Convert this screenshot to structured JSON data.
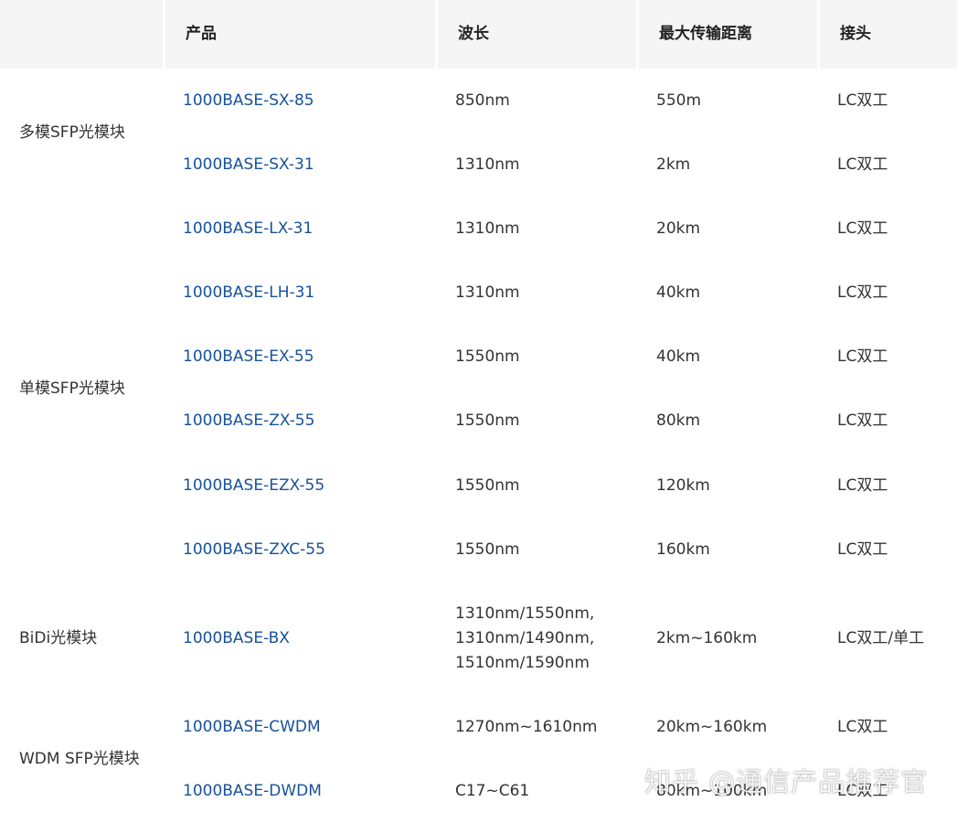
{
  "header": {
    "category": "",
    "product": "产品",
    "wavelength": "波长",
    "distance": "最大传输距离",
    "connector": "接头"
  },
  "categories": {
    "multimode": "多模SFP光模块",
    "singlemode": "单模SFP光模块",
    "bidi": "BiDi光模块",
    "wdm": "WDM SFP光模块"
  },
  "rows": [
    {
      "product": "1000BASE-SX-85",
      "wavelength": "850nm",
      "distance": "550m",
      "connector": "LC双工"
    },
    {
      "product": "1000BASE-SX-31",
      "wavelength": "1310nm",
      "distance": "2km",
      "connector": "LC双工"
    },
    {
      "product": "1000BASE-LX-31",
      "wavelength": "1310nm",
      "distance": "20km",
      "connector": "LC双工"
    },
    {
      "product": "1000BASE-LH-31",
      "wavelength": "1310nm",
      "distance": "40km",
      "connector": "LC双工"
    },
    {
      "product": "1000BASE-EX-55",
      "wavelength": "1550nm",
      "distance": "40km",
      "connector": "LC双工"
    },
    {
      "product": "1000BASE-ZX-55",
      "wavelength": "1550nm",
      "distance": "80km",
      "connector": "LC双工"
    },
    {
      "product": "1000BASE-EZX-55",
      "wavelength": "1550nm",
      "distance": "120km",
      "connector": "LC双工"
    },
    {
      "product": "1000BASE-ZXC-55",
      "wavelength": "1550nm",
      "distance": "160km",
      "connector": "LC双工"
    },
    {
      "product": "1000BASE-BX",
      "wavelength_lines": [
        "1310nm/1550nm,",
        "1310nm/1490nm,",
        "1510nm/1590nm"
      ],
      "distance": "2km~160km",
      "connector": "LC双工/单工"
    },
    {
      "product": "1000BASE-CWDM",
      "wavelength": "1270nm~1610nm",
      "distance": "20km~160km",
      "connector": "LC双工"
    },
    {
      "product": "1000BASE-DWDM",
      "wavelength": "C17~C61",
      "distance": "80km~100km",
      "connector": "LC双工"
    }
  ],
  "watermark": "知乎 @通信产品推荐官",
  "colors": {
    "link": "#175199",
    "header_bg": "#f5f5f5",
    "text": "#333333"
  }
}
